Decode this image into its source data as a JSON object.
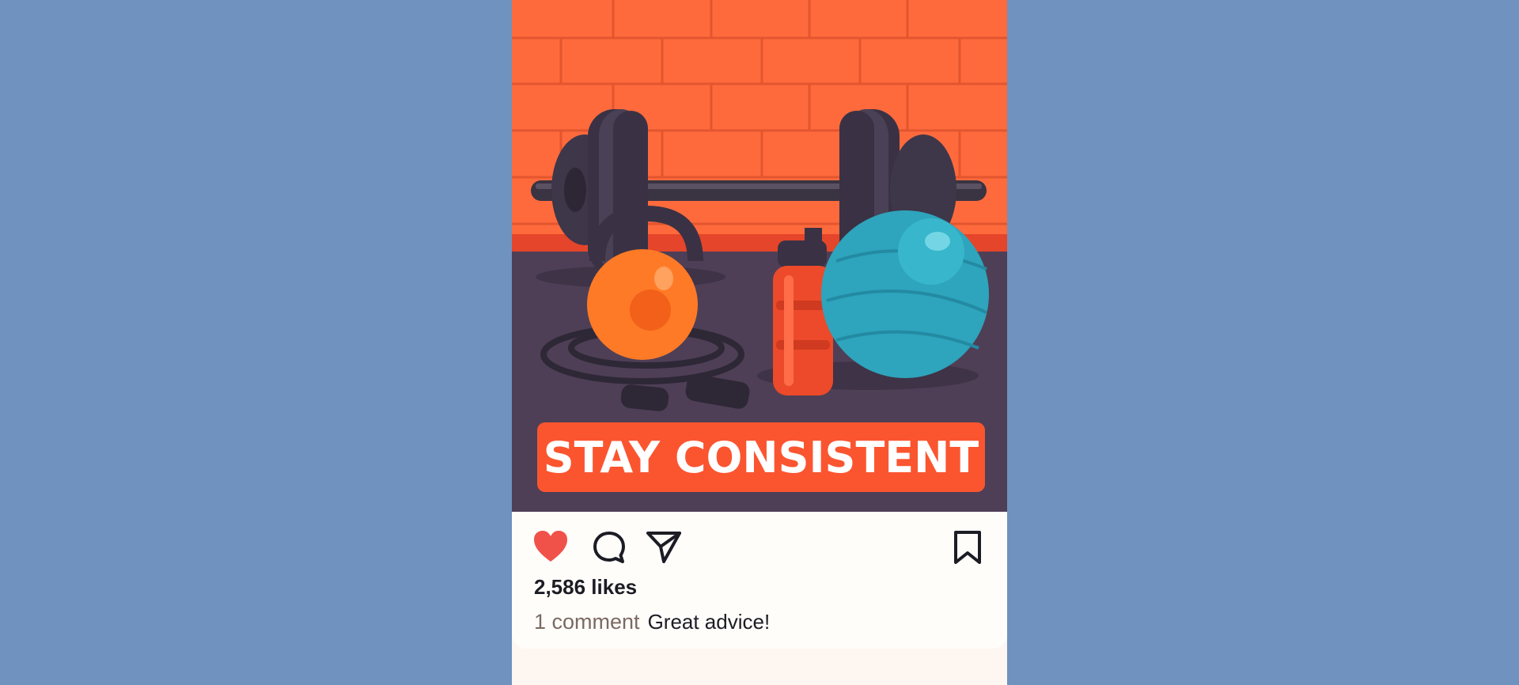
{
  "post": {
    "banner_text": "STAY CONSISTENT",
    "likes_text": "2,586 likes",
    "comment_count_text": "1 comment",
    "comment_text": "Great advice!",
    "liked": true
  },
  "icons": {
    "like": "heart-icon",
    "comment": "speech-bubble-icon",
    "share": "paper-plane-icon",
    "save": "bookmark-icon"
  },
  "colors": {
    "background": "#6f92bf",
    "brick_wall": "#ff6a3d",
    "floor": "#4e3f56",
    "banner": "#fb5530",
    "like_active": "#f0524a",
    "text": "#1c1c24",
    "muted_text": "#7b6a62"
  }
}
